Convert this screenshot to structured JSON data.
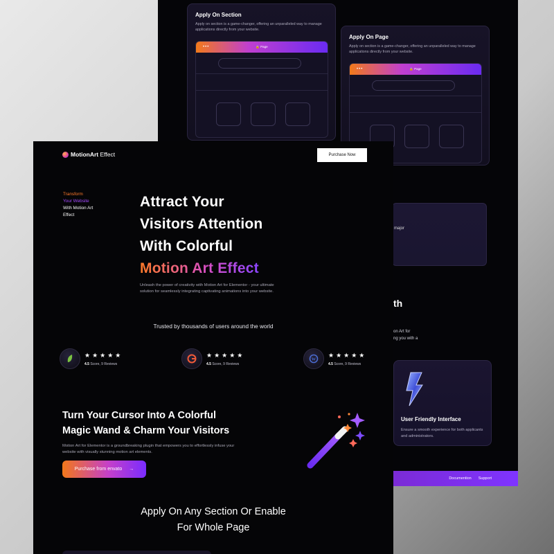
{
  "back_panel": {
    "apply_section_card": {
      "title": "Apply On Section",
      "desc": "Apply on section is a game-changer, offering an unparalleled way to manage applications directly from your website.",
      "mock": {
        "dots": "•••",
        "page_label": "🔒 Page"
      }
    },
    "apply_page_card": {
      "title": "Apply On Page",
      "desc": "Apply on section is a game-changer, offering an unparalleled way to manage applications directly from your website.",
      "mock": {
        "dots": "•••",
        "page_label": "🔒 Page"
      }
    },
    "fragments": {
      "major": "major",
      "th": "th",
      "line1": "on Art for",
      "line2": "ng you with a"
    },
    "user_friendly": {
      "title": "User Friendly Interface",
      "desc": "Ensure a smooth experience for both applicants and administrators."
    },
    "footer_links": [
      "Documention",
      "Support"
    ]
  },
  "front_panel": {
    "logo": {
      "brand": "MotionArt",
      "suffix": " Effect"
    },
    "purchase_button": "Purchase Now",
    "side_note": {
      "line1": "Transform",
      "line2": "Your Website",
      "line3": "With Motion Art",
      "line4": "Effect"
    },
    "hero": {
      "line1": "Attract Your",
      "line2": "Visitors Attention",
      "line3": "With Colorful",
      "highlight": "Motion Art Effect",
      "desc": "Unleash the power of creativity with Motion Art for Elementor - your ultimate solution for seamlessly integrating captivating animations into your website."
    },
    "trusted": "Trusted by thousands of users around the world",
    "reviews": [
      {
        "icon": "envato-icon",
        "stars": "★★★★★",
        "score": "4.5",
        "text": "Score, 9 Reviews"
      },
      {
        "icon": "g2-icon",
        "stars": "★★★★★",
        "score": "4.5",
        "text": "Score, 9 Reviews"
      },
      {
        "icon": "wordpress-icon",
        "stars": "★★★★★",
        "score": "4.5",
        "text": "Score, 9 Reviews"
      }
    ],
    "section2": {
      "line1": "Turn Your Cursor Into A Colorful",
      "line2": "Magic Wand & Charm Your Visitors",
      "desc": "Motion Art for Elementor is a groundbreaking plugin that empowers you to effortlessly infuse your website with visually stunning motion art elements.",
      "button": "Purchase from envato",
      "button_arrow": "→"
    },
    "section3": {
      "line1": "Apply On Any Section Or Enable",
      "line2": "For Whole Page"
    }
  },
  "colors": {
    "orange": "#f2781a",
    "purple": "#7a2cff",
    "panel_bg": "#050507"
  }
}
